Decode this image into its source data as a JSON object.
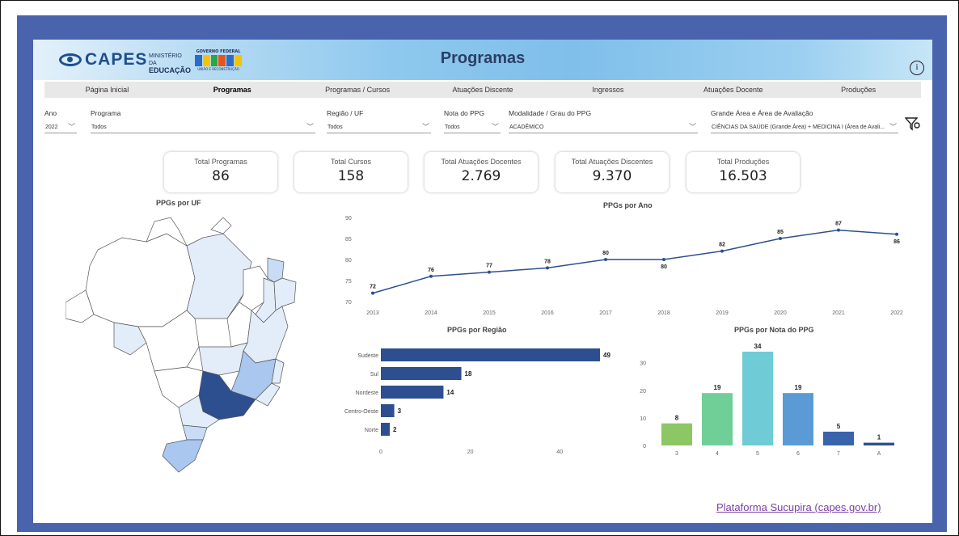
{
  "header": {
    "logo_text": "CAPES",
    "ministerio_line1": "MINISTÉRIO DA",
    "ministerio_line2": "EDUCAÇÃO",
    "gov_top": "GOVERNO FEDERAL",
    "gov_sub": "UNIÃO E RECONSTRUÇÃO",
    "title": "Programas",
    "info_label": "i"
  },
  "nav": [
    {
      "label": "Página Inicial",
      "active": false
    },
    {
      "label": "Programas",
      "active": true
    },
    {
      "label": "Programas / Cursos",
      "active": false
    },
    {
      "label": "Atuações Discente",
      "active": false
    },
    {
      "label": "Ingressos",
      "active": false
    },
    {
      "label": "Atuações Docente",
      "active": false
    },
    {
      "label": "Produções",
      "active": false
    }
  ],
  "filters": {
    "ano": {
      "label": "Ano",
      "value": "2022"
    },
    "programa": {
      "label": "Programa",
      "value": "Todos"
    },
    "regiao": {
      "label": "Região / UF",
      "value": "Todos"
    },
    "nota": {
      "label": "Nota do PPG",
      "value": "Todos"
    },
    "modalidade": {
      "label": "Modalidade / Grau do PPG",
      "value": "ACADÊMICO"
    },
    "area": {
      "label": "Grande Área e Área de Avaliação",
      "value": "CIÊNCIAS DA SAÚDE (Grande Área) + MEDICINA I (Área de Avali..."
    }
  },
  "kpis": [
    {
      "label": "Total Programas",
      "value": "86"
    },
    {
      "label": "Total Cursos",
      "value": "158"
    },
    {
      "label": "Total Atuações Docentes",
      "value": "2.769"
    },
    {
      "label": "Total Atuações Discentes",
      "value": "9.370"
    },
    {
      "label": "Total Produções",
      "value": "16.503"
    }
  ],
  "map": {
    "title": "PPGs por UF"
  },
  "colors": {
    "navy": "#2e4f8f",
    "link": "#7a3fa4",
    "frame": "#4a63ad"
  },
  "chart_data": [
    {
      "type": "line",
      "title": "PPGs por Ano",
      "x": [
        "2013",
        "2014",
        "2015",
        "2016",
        "2017",
        "2018",
        "2019",
        "2020",
        "2021",
        "2022"
      ],
      "values": [
        72,
        76,
        77,
        78,
        80,
        80,
        82,
        85,
        87,
        86
      ],
      "ylim": [
        70,
        90
      ],
      "yticks": [
        70,
        75,
        80,
        85,
        90
      ]
    },
    {
      "type": "bar",
      "orientation": "horizontal",
      "title": "PPGs por Região",
      "categories": [
        "Sudeste",
        "Sul",
        "Nordeste",
        "Centro-Oeste",
        "Norte"
      ],
      "values": [
        49,
        18,
        14,
        3,
        2
      ],
      "xlim": [
        0,
        49
      ],
      "xticks": [
        0,
        20,
        40
      ]
    },
    {
      "type": "bar",
      "title": "PPGs por Nota do PPG",
      "categories": [
        "3",
        "4",
        "5",
        "6",
        "7",
        "A"
      ],
      "values": [
        8,
        19,
        34,
        19,
        5,
        1
      ],
      "colors": [
        "#8cc665",
        "#6fcf97",
        "#6fcbd6",
        "#5b9bd5",
        "#3a63ad",
        "#2e4f8f"
      ],
      "ylim": [
        0,
        34
      ],
      "yticks": [
        0,
        10,
        20,
        30
      ]
    }
  ],
  "footer": {
    "link": "Plataforma Sucupira (capes.gov.br)"
  }
}
